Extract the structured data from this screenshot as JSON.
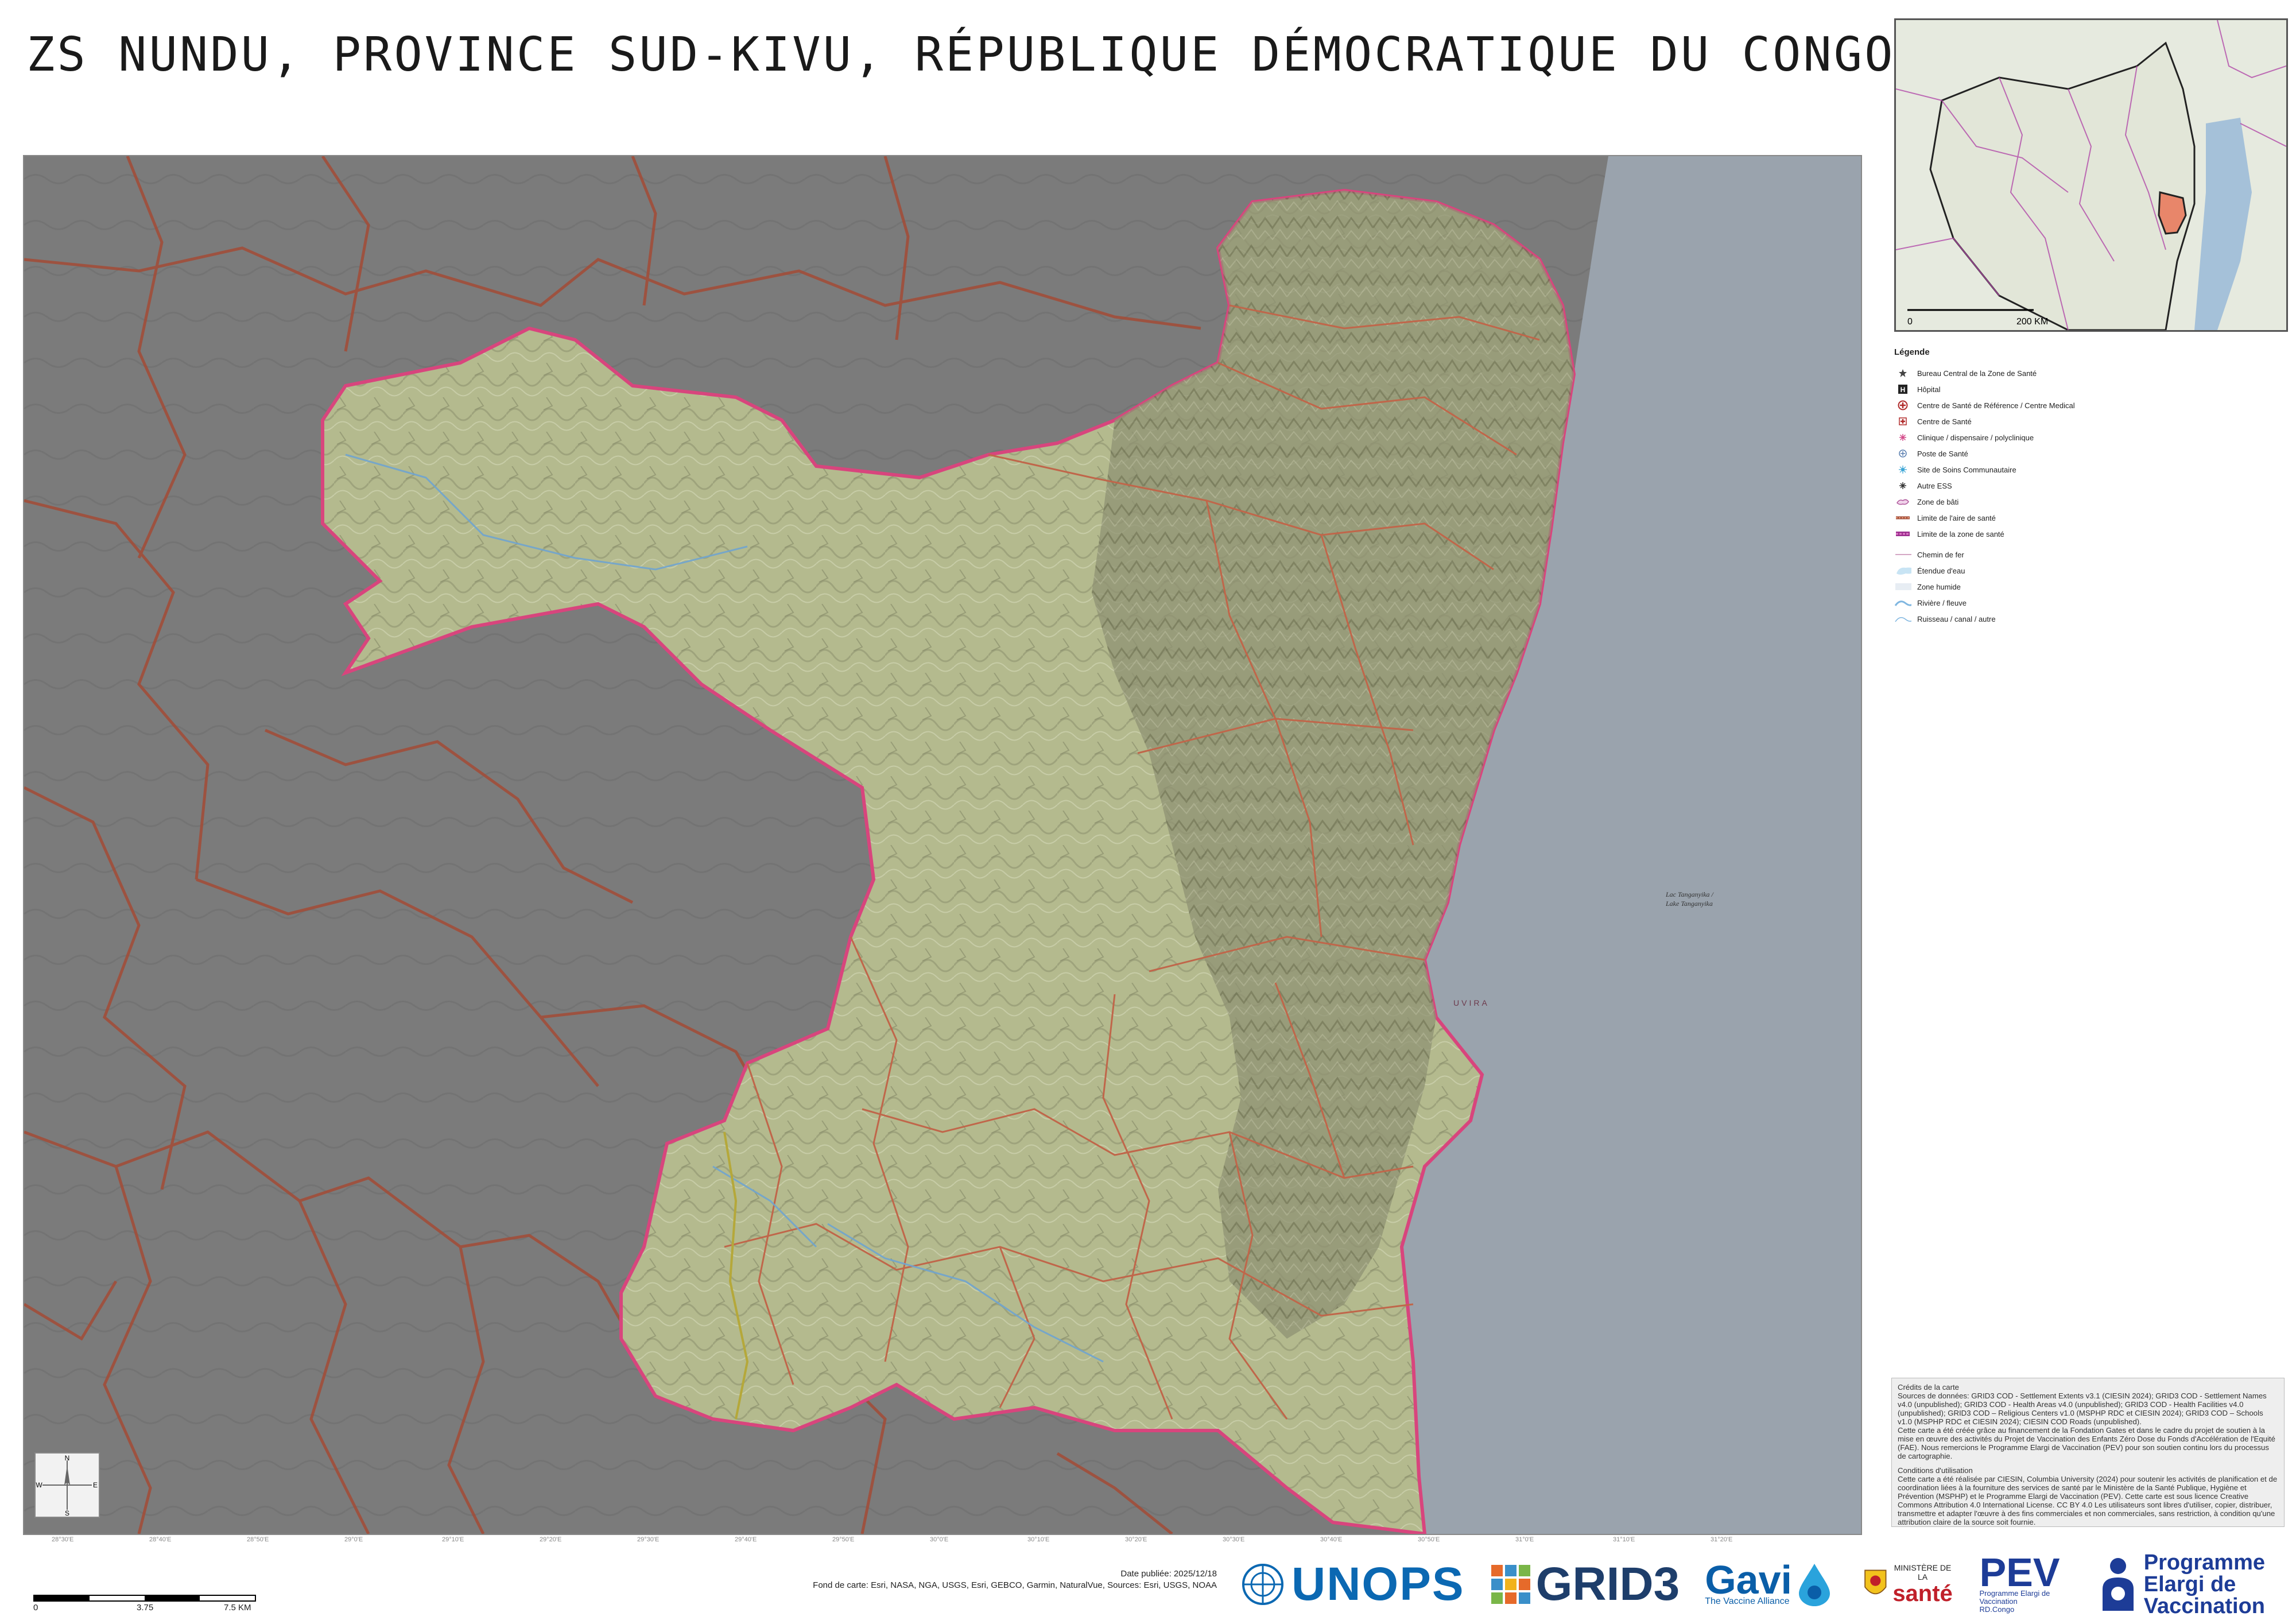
{
  "title": "ZS NUNDU, PROVINCE SUD-KIVU, RÉPUBLIQUE DÉMOCRATIQUE DU CONGO",
  "map": {
    "lake_label_line1": "Lac Tanganyika /",
    "lake_label_line2": "Lake Tanganyika",
    "lake_color": "#9aa3ad",
    "zone_fill": "#b9bf95",
    "outside_fill": "#7b7b7b",
    "boundary_color": "#a14e3a",
    "zone_boundary_color": "#d8457d",
    "place_label": "UVIRA"
  },
  "coordinate_labels": [
    "28°30'E",
    "28°40'E",
    "28°50'E",
    "29°0'E",
    "29°10'E",
    "29°20'E",
    "29°30'E",
    "29°40'E",
    "29°50'E",
    "30°0'E",
    "30°10'E",
    "30°20'E",
    "30°30'E",
    "30°40'E",
    "30°50'E",
    "31°0'E",
    "31°10'E",
    "31°20'E"
  ],
  "inset": {
    "scale_start": "0",
    "scale_end": "200 KM"
  },
  "legend": {
    "heading": "Légende",
    "items": [
      {
        "label": "Bureau Central de la Zone de Santé",
        "icon": "star-icon"
      },
      {
        "label": "Hôpital",
        "icon": "hospital-icon"
      },
      {
        "label": "Centre de Santé de Référence / Centre Medical",
        "icon": "reference-center-icon"
      },
      {
        "label": "Centre de Santé",
        "icon": "health-center-icon"
      },
      {
        "label": "Clinique / dispensaire / polyclinique",
        "icon": "clinic-icon"
      },
      {
        "label": "Poste de Santé",
        "icon": "health-post-icon"
      },
      {
        "label": "Site de Soins Communautaire",
        "icon": "community-care-icon"
      },
      {
        "label": "Autre ESS",
        "icon": "other-facility-icon"
      },
      {
        "label": "Zone de bâti",
        "icon": "built-zone-icon"
      },
      {
        "label": "Limite de l'aire de santé",
        "icon": "health-area-boundary-icon"
      },
      {
        "label": "Limite de la zone de santé",
        "icon": "health-zone-boundary-icon"
      },
      {
        "label": "Chemin de fer",
        "icon": "railway-icon"
      },
      {
        "label": "Étendue d'eau",
        "icon": "water-body-icon"
      },
      {
        "label": "Zone humide",
        "icon": "wetland-icon"
      },
      {
        "label": "Rivière / fleuve",
        "icon": "river-icon"
      },
      {
        "label": "Ruisseau / canal / autre",
        "icon": "stream-icon"
      }
    ]
  },
  "credits": {
    "heading": "Crédits de la carte",
    "sources": "Sources de données: GRID3 COD - Settlement Extents v3.1 (CIESIN 2024); GRID3 COD - Settlement Names v4.0 (unpublished); GRID3 COD - Health Areas v4.0 (unpublished); GRID3 COD - Health Facilities v4.0 (unpublished); GRID3 COD – Religious Centers v1.0 (MSPHP RDC et CIESIN 2024); GRID3 COD – Schools v1.0 (MSPHP RDC et CIESIN 2024); CIESIN COD Roads (unpublished).",
    "funding": "Cette carte a été créée grâce au financement de la Fondation Gates et dans le cadre du projet de soutien à la mise en œuvre des activités du Projet de Vaccination des Enfants Zéro Dose du Fonds d'Accélération de l'Equité (FAE). Nous remercions le Programme Elargi de Vaccination (PEV) pour son soutien continu lors du processus de cartographie.",
    "conditions_heading": "Conditions d'utilisation",
    "conditions": "Cette carte a été réalisée par CIESIN, Columbia University (2024) pour soutenir les activités de planification et de coordination liées à la fourniture des services de santé par le Ministère de la Santé Publique, Hygiène et Prévention (MSPHP) et le Programme Elargi de Vaccination (PEV). Cette carte est sous licence Creative Commons Attribution 4.0 International License. CC BY 4.0 Les utilisateurs sont libres d'utiliser, copier, distribuer, transmettre et adapter l'œuvre à des fins commerciales et non commerciales, sans restriction, à condition qu'une attribution claire de la source soit fournie."
  },
  "scalebar": {
    "start": "0",
    "mid": "3.75",
    "end": "7.5 KM"
  },
  "meta": {
    "date": "Date publiée: 2025/12/18",
    "basemap": "Fond de carte: Esri, NASA, NGA, USGS, Esri, GEBCO, Garmin, NaturalVue, Sources: Esri, USGS, NOAA"
  },
  "compass": {
    "n": "N",
    "s": "S",
    "e": "E",
    "w": "W"
  },
  "logos": {
    "unops": "UNOPS",
    "grid3": "GRID3",
    "gavi": "Gavi",
    "gavi_sub": "The Vaccine Alliance",
    "sante_top": "MINISTÈRE DE LA",
    "sante_main": "santé",
    "pev": "PEV",
    "pev_sub1": "Programme Elargi de Vaccination",
    "pev_sub2": "RD.Congo",
    "programme_line1": "Programme",
    "programme_line2": "Elargi de",
    "programme_line3": "Vaccination"
  }
}
